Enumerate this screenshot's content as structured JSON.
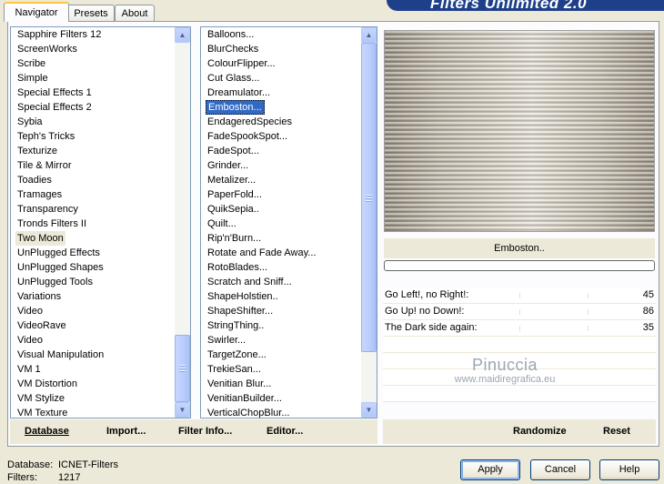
{
  "tabs": {
    "navigator": "Navigator",
    "presets": "Presets",
    "about": "About"
  },
  "banner_title": "Filters Unlimited 2.0",
  "categories": [
    "Sapphire Filters 12",
    "ScreenWorks",
    "Scribe",
    "Simple",
    "Special Effects 1",
    "Special Effects 2",
    "Sybia",
    "Teph's Tricks",
    "Texturize",
    "Tile & Mirror",
    "Toadies",
    "Tramages",
    "Transparency",
    "Tronds Filters II",
    "Two Moon",
    "UnPlugged Effects",
    "UnPlugged Shapes",
    "UnPlugged Tools",
    "Variations",
    "Video",
    "VideoRave",
    "Video",
    "Visual Manipulation",
    "VM 1",
    "VM Distortion",
    "VM Stylize",
    "VM Texture"
  ],
  "filters": [
    "Balloons...",
    "BlurChecks",
    "ColourFlipper...",
    "Cut Glass...",
    "Dreamulator...",
    "Emboston...",
    "EndageredSpecies",
    "FadeSpookSpot...",
    "FadeSpot...",
    "Grinder...",
    "Metalizer...",
    "PaperFold...",
    "QuikSepia..",
    "Quilt...",
    "Rip'n'Burn...",
    "Rotate and Fade Away...",
    "RotoBlades...",
    "Scratch and Sniff...",
    "ShapeHolstien..",
    "ShapeShifter...",
    "StringThing..",
    "Swirler...",
    "TargetZone...",
    "TrekieSan...",
    "Venitian Blur...",
    "VenitianBuilder...",
    "VerticalChopBlur..."
  ],
  "selected_filter": "Emboston..",
  "params": [
    {
      "label": "Go Left!, no Right!:",
      "value": "45"
    },
    {
      "label": "Go Up! no Down!:",
      "value": "86"
    },
    {
      "label": "The Dark side again:",
      "value": "35"
    }
  ],
  "watermark": {
    "name": "Pinuccia",
    "site": "www.maidiregrafica.eu"
  },
  "toolbar": {
    "database": "Database",
    "import": "Import...",
    "filter_info": "Filter Info...",
    "editor": "Editor...",
    "randomize": "Randomize",
    "reset": "Reset"
  },
  "status": {
    "database_label": "Database:",
    "database_value": "ICNET-Filters",
    "filters_label": "Filters:",
    "filters_value": "1217"
  },
  "buttons": {
    "apply": "Apply",
    "cancel": "Cancel",
    "help": "Help"
  }
}
